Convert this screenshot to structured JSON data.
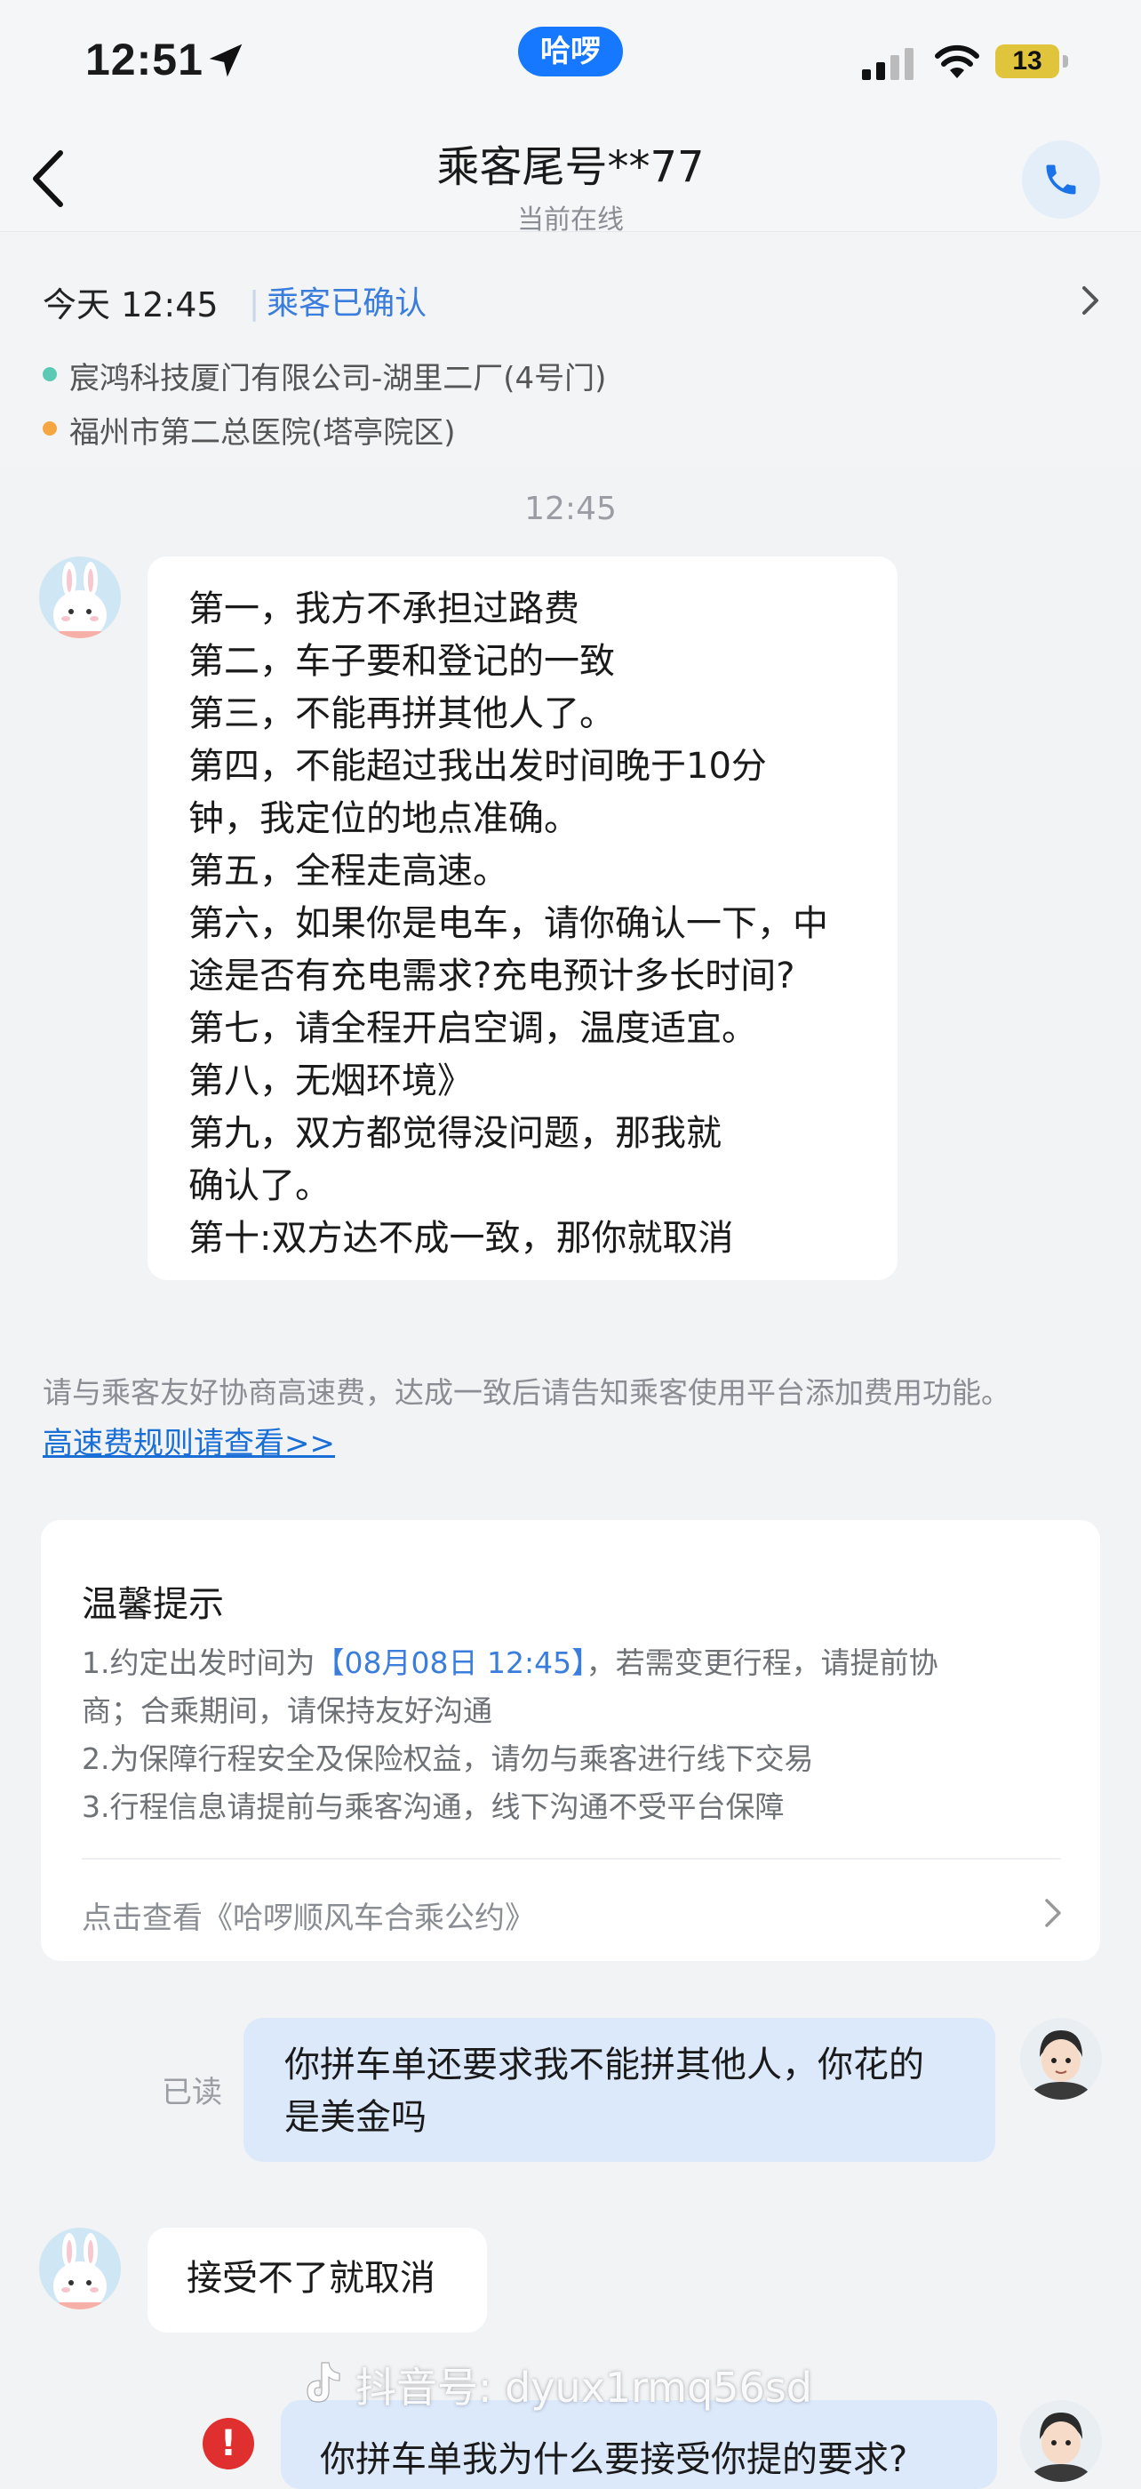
{
  "status_bar": {
    "time": "12:51",
    "app_badge": "哈啰",
    "battery": "13"
  },
  "header": {
    "title": "乘客尾号**77",
    "subtitle": "当前在线",
    "call_icon": "phone-icon"
  },
  "trip": {
    "time": "今天 12:45",
    "status": "乘客已确认",
    "origin": "宸鸿科技厦门有限公司-湖里二厂(4号门)",
    "destination": "福州市第二总医院(塔亭院区)",
    "origin_dot_color": "#5cc9b4",
    "destination_dot_color": "#f5a640"
  },
  "chat": {
    "timestamp": "12:45",
    "passenger_message_1": [
      "第一，我方不承担过路费",
      "第二，车子要和登记的一致",
      "第三，不能再拼其他人了。",
      "第四，不能超过我出发时间晚于10分",
      "钟，我定位的地点准确。",
      "第五，全程走高速。",
      "第六，如果你是电车，请你确认一下，中",
      "途是否有充电需求?充电预计多长时间?",
      "第七，请全程开启空调，温度适宜。",
      "第八，无烟环境》",
      "第九，双方都觉得没问题，那我就",
      "确认了。",
      "第十:双方达不成一致，那你就取消"
    ],
    "system_note": "请与乘客友好协商高速费，达成一致后请告知乘客使用平台添加费用功能。",
    "system_link": "高速费规则请查看>>",
    "driver_message_1": [
      "你拼车单还要求我不能拼其他人，你花的",
      "是美金吗"
    ],
    "read_label": "已读",
    "passenger_message_2": "接受不了就取消",
    "driver_message_2_partial": "你拼车单我为什么要接受你提的要求?",
    "error_mark": "!"
  },
  "tips": {
    "title": "温馨提示",
    "line1_before": "1.约定出发时间为",
    "line1_highlight": "【08月08日 12:45】",
    "line1_after": "，若需变更行程，请提前协",
    "line1_cont": "商；合乘期间，请保持友好沟通",
    "line2": "2.为保障行程安全及保险权益，请勿与乘客进行线下交易",
    "line3": "3.行程信息请提前与乘客沟通，线下沟通不受平台保障",
    "link": "点击查看《哈啰顺风车合乘公约》"
  },
  "watermark": "抖音号: dyux1rmq56sd"
}
